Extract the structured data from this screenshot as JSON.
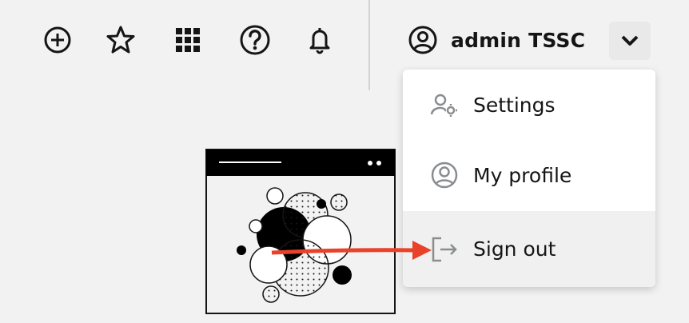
{
  "toolbar": {
    "icons": [
      "plus-circle-icon",
      "star-icon",
      "grid-icon",
      "help-icon",
      "bell-icon"
    ]
  },
  "user": {
    "name": "admin TSSC",
    "avatar_icon": "user-circle-icon",
    "dropdown_icon": "chevron-down-icon"
  },
  "menu": {
    "items": [
      {
        "label": "Settings",
        "icon": "user-gear-icon"
      },
      {
        "label": "My profile",
        "icon": "user-circle-icon"
      },
      {
        "label": "Sign out",
        "icon": "sign-out-icon",
        "highlighted": true
      }
    ]
  },
  "colors": {
    "background": "#f2f2f2",
    "annotation_arrow": "#e8432a",
    "text": "#151515",
    "icon_gray": "#8a8d90"
  }
}
